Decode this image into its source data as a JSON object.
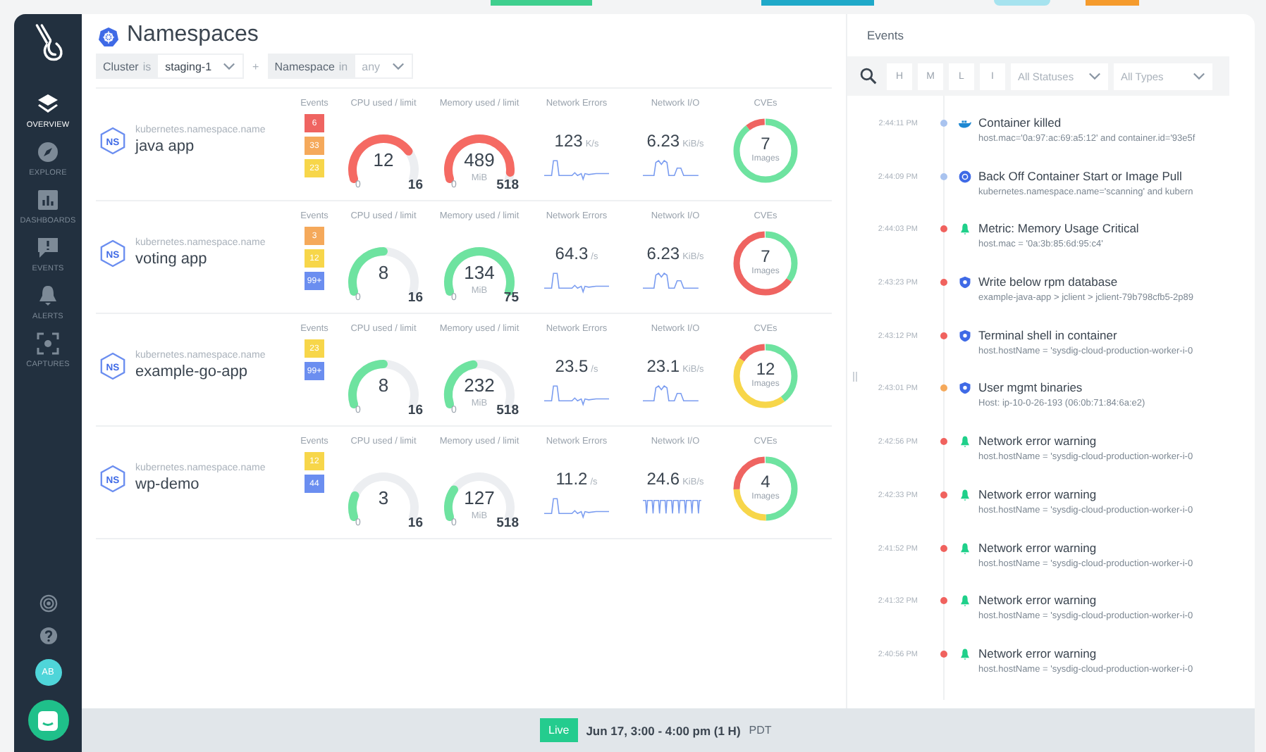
{
  "sidebar": {
    "items": [
      {
        "label": "OVERVIEW",
        "kind": "layers",
        "selected": true
      },
      {
        "label": "EXPLORE",
        "kind": "compass",
        "selected": false
      },
      {
        "label": "DASHBOARDS",
        "kind": "chart",
        "selected": false
      },
      {
        "label": "EVENTS",
        "kind": "alert",
        "selected": false
      },
      {
        "label": "ALERTS",
        "kind": "bell",
        "selected": false
      },
      {
        "label": "CAPTURES",
        "kind": "capture",
        "selected": false
      }
    ],
    "avatar": "AB"
  },
  "header": {
    "title": "Namespaces",
    "filters": [
      {
        "key": "Cluster",
        "op": "is",
        "value": "staging-1"
      },
      {
        "key": "Namespace",
        "op": "in",
        "placeholder": "any"
      }
    ],
    "joiner": "+"
  },
  "namespaces": [
    {
      "badge": "NS",
      "label": "kubernetes.namespace.name",
      "name": "java app",
      "events_title": "Events",
      "events": [
        {
          "text": "6",
          "color": "#ef6461"
        },
        {
          "text": "33",
          "color": "#f5a95b"
        },
        {
          "text": "23",
          "color": "#f7d64a"
        }
      ],
      "cpu": {
        "title": "CPU used / limit",
        "value": "12",
        "min": "0",
        "max": "16",
        "color": "#f56a63"
      },
      "memory": {
        "title": "Memory used / limit",
        "value": "489",
        "unit": "MiB",
        "min": "0",
        "max": "518",
        "color": "#f56a63"
      },
      "net_errors": {
        "title": "Network Errors",
        "value": "123",
        "unit": "K/s",
        "kind": "bump"
      },
      "net_io": {
        "title": "Network I/O",
        "value": "6.23",
        "unit": "KiB/s",
        "kind": "double"
      },
      "cves": {
        "title": "CVEs",
        "value": "7",
        "label": "Images",
        "segments": [
          {
            "color": "#6ee3a0",
            "level": 0.9
          },
          {
            "color": "#ef6461",
            "level": 0.1
          }
        ]
      }
    },
    {
      "badge": "NS",
      "label": "kubernetes.namespace.name",
      "name": "voting app",
      "events_title": "Events",
      "events": [
        {
          "text": "3",
          "color": "#f5a95b"
        },
        {
          "text": "12",
          "color": "#f7d64a"
        },
        {
          "text": "99+",
          "color": "#6b8ef0"
        }
      ],
      "cpu": {
        "title": "CPU used / limit",
        "value": "8",
        "min": "0",
        "max": "16",
        "color": "#6ee3a0"
      },
      "memory": {
        "title": "Memory used / limit",
        "value": "134",
        "unit": "MiB",
        "min": "0",
        "max": "75",
        "color": "#6ee3a0"
      },
      "net_errors": {
        "title": "Network Errors",
        "value": "64.3",
        "unit": "/s",
        "kind": "bump"
      },
      "net_io": {
        "title": "Network I/O",
        "value": "6.23",
        "unit": "KiB/s",
        "kind": "double"
      },
      "cves": {
        "title": "CVEs",
        "value": "7",
        "label": "Images",
        "segments": [
          {
            "color": "#6ee3a0",
            "level": 0.35
          },
          {
            "color": "#ef6461",
            "level": 0.65
          }
        ]
      }
    },
    {
      "badge": "NS",
      "label": "kubernetes.namespace.name",
      "name": "example-go-app",
      "events_title": "Events",
      "events": [
        {
          "text": "23",
          "color": "#f7d64a"
        },
        {
          "text": "99+",
          "color": "#6b8ef0"
        }
      ],
      "cpu": {
        "title": "CPU used / limit",
        "value": "8",
        "min": "0",
        "max": "16",
        "color": "#6ee3a0"
      },
      "memory": {
        "title": "Memory used / limit",
        "value": "232",
        "unit": "MiB",
        "min": "0",
        "max": "518",
        "color": "#6ee3a0"
      },
      "net_errors": {
        "title": "Network Errors",
        "value": "23.5",
        "unit": "/s",
        "kind": "bump"
      },
      "net_io": {
        "title": "Network I/O",
        "value": "23.1",
        "unit": "KiB/s",
        "kind": "double"
      },
      "cves": {
        "title": "CVEs",
        "value": "12",
        "label": "Images",
        "segments": [
          {
            "color": "#6ee3a0",
            "level": 0.4
          },
          {
            "color": "#f7d64a",
            "level": 0.45
          },
          {
            "color": "#ef6461",
            "level": 0.15
          }
        ]
      }
    },
    {
      "badge": "NS",
      "label": "kubernetes.namespace.name",
      "name": "wp-demo",
      "events_title": "Events",
      "events": [
        {
          "text": "12",
          "color": "#f7d64a"
        },
        {
          "text": "44",
          "color": "#6b8ef0"
        }
      ],
      "cpu": {
        "title": "CPU used / limit",
        "value": "3",
        "min": "0",
        "max": "16",
        "color": "#6ee3a0"
      },
      "memory": {
        "title": "Memory used / limit",
        "value": "127",
        "unit": "MiB",
        "min": "0",
        "max": "518",
        "color": "#6ee3a0"
      },
      "net_errors": {
        "title": "Network Errors",
        "value": "11.2",
        "unit": "/s",
        "kind": "bump"
      },
      "net_io": {
        "title": "Network I/O",
        "value": "24.6",
        "unit": "KiB/s",
        "kind": "comb"
      },
      "cves": {
        "title": "CVEs",
        "value": "4",
        "label": "Images",
        "segments": [
          {
            "color": "#6ee3a0",
            "level": 0.5
          },
          {
            "color": "#f7d64a",
            "level": 0.25
          },
          {
            "color": "#ef6461",
            "level": 0.25
          }
        ]
      }
    }
  ],
  "events_panel": {
    "title": "Events",
    "severity_buttons": [
      "H",
      "M",
      "L",
      "I"
    ],
    "selects": [
      {
        "placeholder": "All Statuses"
      },
      {
        "placeholder": "All Types"
      }
    ],
    "items": [
      {
        "time": "2:44:11 PM",
        "color": "#a9c3ef",
        "kind": "whale",
        "title": "Container killed",
        "detail": "host.mac='0a:97:ac:69:a5:12' and container.id='93e5f"
      },
      {
        "time": "2:44:09 PM",
        "color": "#a9c3ef",
        "kind": "wheel",
        "title": "Back Off Container Start or Image Pull",
        "detail": "kubernetes.namespace.name='scanning' and kubern"
      },
      {
        "time": "2:44:03 PM",
        "color": "#f0625e",
        "kind": "bell",
        "title": "Metric: Memory Usage Critical",
        "detail": "host.mac = '0a:3b:85:6d:95:c4'"
      },
      {
        "time": "2:43:23 PM",
        "color": "#f0625e",
        "kind": "shield",
        "title": "Write below rpm database",
        "detail": "example-java-app > jclient > jclient-79b798cfb5-2p89"
      },
      {
        "time": "2:43:12 PM",
        "color": "#f0625e",
        "kind": "shield",
        "title": "Terminal shell in container",
        "detail": "host.hostName = 'sysdig-cloud-production-worker-i-0"
      },
      {
        "time": "2:43:01 PM",
        "color": "#f5a95b",
        "kind": "shield",
        "title": "User mgmt binaries",
        "detail": "Host: ip-10-0-26-193 (06:0b:71:84:6a:e2)"
      },
      {
        "time": "2:42:56 PM",
        "color": "#f0625e",
        "kind": "bell",
        "title": "Network error warning",
        "detail": "host.hostName = 'sysdig-cloud-production-worker-i-0"
      },
      {
        "time": "2:42:33 PM",
        "color": "#f0625e",
        "kind": "bell",
        "title": "Network error warning",
        "detail": "host.hostName = 'sysdig-cloud-production-worker-i-0"
      },
      {
        "time": "2:41:52 PM",
        "color": "#f0625e",
        "kind": "bell",
        "title": "Network error warning",
        "detail": "host.hostName = 'sysdig-cloud-production-worker-i-0"
      },
      {
        "time": "2:41:32 PM",
        "color": "#f0625e",
        "kind": "bell",
        "title": "Network error warning",
        "detail": "host.hostName = 'sysdig-cloud-production-worker-i-0"
      },
      {
        "time": "2:40:56 PM",
        "color": "#f0625e",
        "kind": "bell",
        "title": "Network error warning",
        "detail": "host.hostName = 'sysdig-cloud-production-worker-i-0"
      }
    ]
  },
  "bottom_bar": {
    "live": "Live",
    "range": "Jun 17, 3:00 - 4:00 pm (1 H)",
    "timezone": "PDT"
  }
}
